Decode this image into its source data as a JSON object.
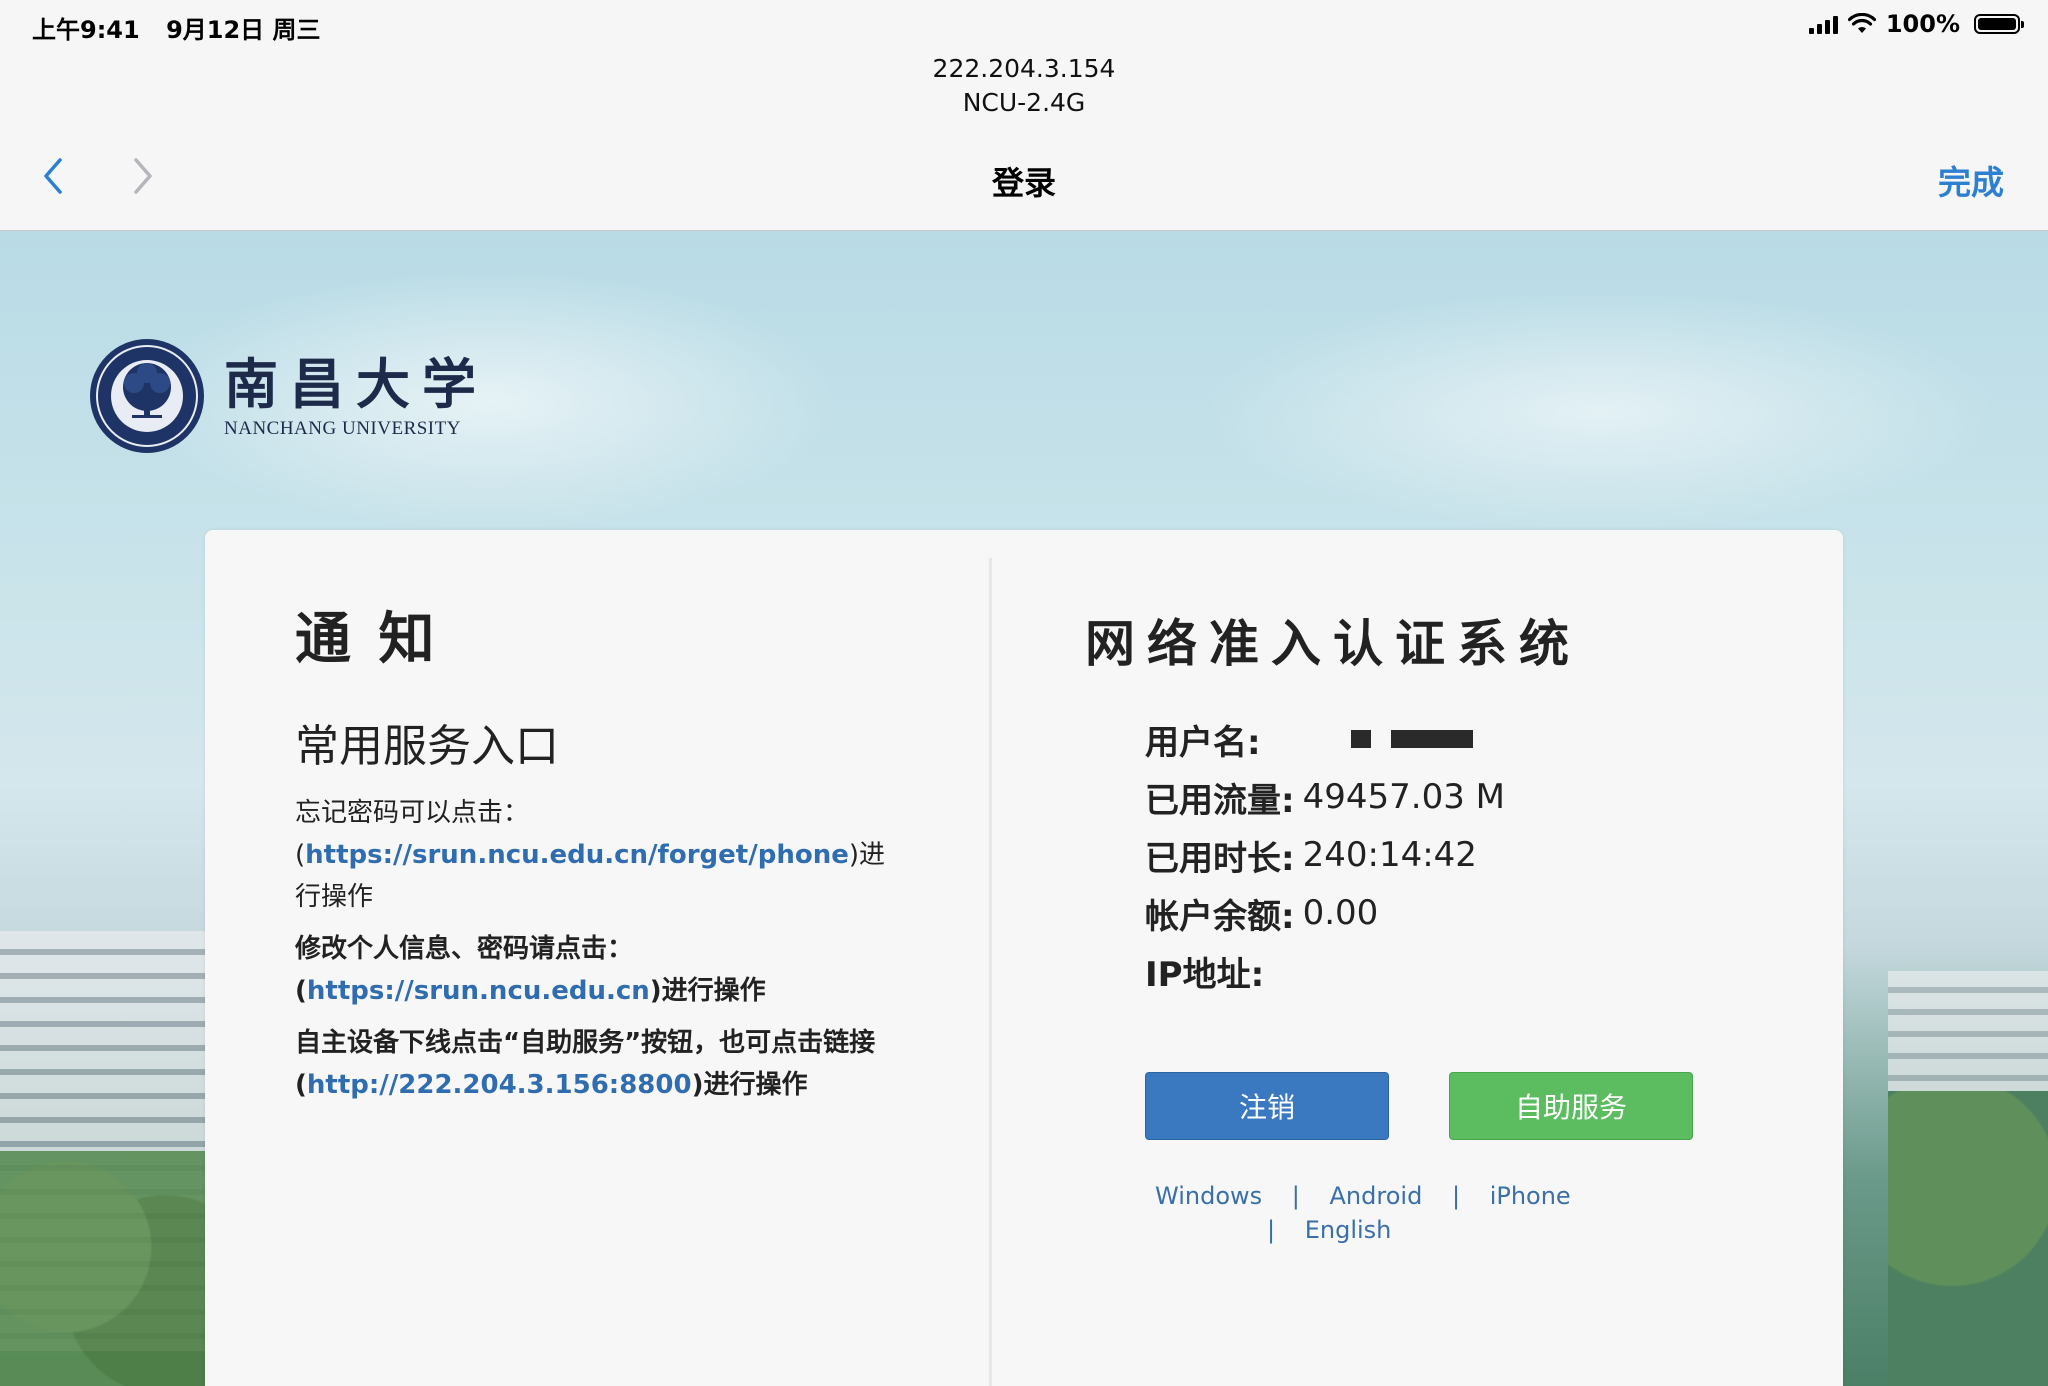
{
  "status_bar": {
    "time": "上午9:41",
    "date": "9月12日 周三",
    "battery_text": "100%",
    "battery_level": 1.0
  },
  "browser": {
    "address": "222.204.3.154",
    "network": "NCU-2.4G",
    "title": "登录",
    "done_label": "完成"
  },
  "logo": {
    "name_cn": "南昌大学",
    "name_en": "NANCHANG UNIVERSITY"
  },
  "notice": {
    "heading": "通 知",
    "subheading": "常用服务入口",
    "items": [
      {
        "prefix": "忘记密码可以点击：(",
        "link": "https://srun.ncu.edu.cn/forget/phone",
        "suffix": ")进行操作"
      },
      {
        "prefix": "修改个人信息、密码请点击：(",
        "link": "https://srun.ncu.edu.cn",
        "suffix": ")进行操作"
      },
      {
        "prefix": "自主设备下线点击“自助服务”按钮，也可点击链接(",
        "link": "http://222.204.3.156:8800",
        "suffix": ")进行操作"
      }
    ]
  },
  "login": {
    "system_title": "网络准入认证系统",
    "username_label": "用户名:",
    "traffic_label": "已用流量:",
    "traffic_value": "49457.03 M",
    "duration_label": "已用时长:",
    "duration_value": "240:14:42",
    "balance_label": "帐户余额:",
    "balance_value": "0.00",
    "ip_label": "IP地址:",
    "logout_label": "注销",
    "selfservice_label": "自助服务",
    "clients": [
      "Windows",
      "Android",
      "iPhone",
      "English"
    ],
    "separator": "|"
  },
  "colors": {
    "ios_blue": "#2d7fd2",
    "link_blue": "#2f6db0",
    "logout_blue": "#3a78c0",
    "selfservice_green": "#5bbd5f"
  }
}
